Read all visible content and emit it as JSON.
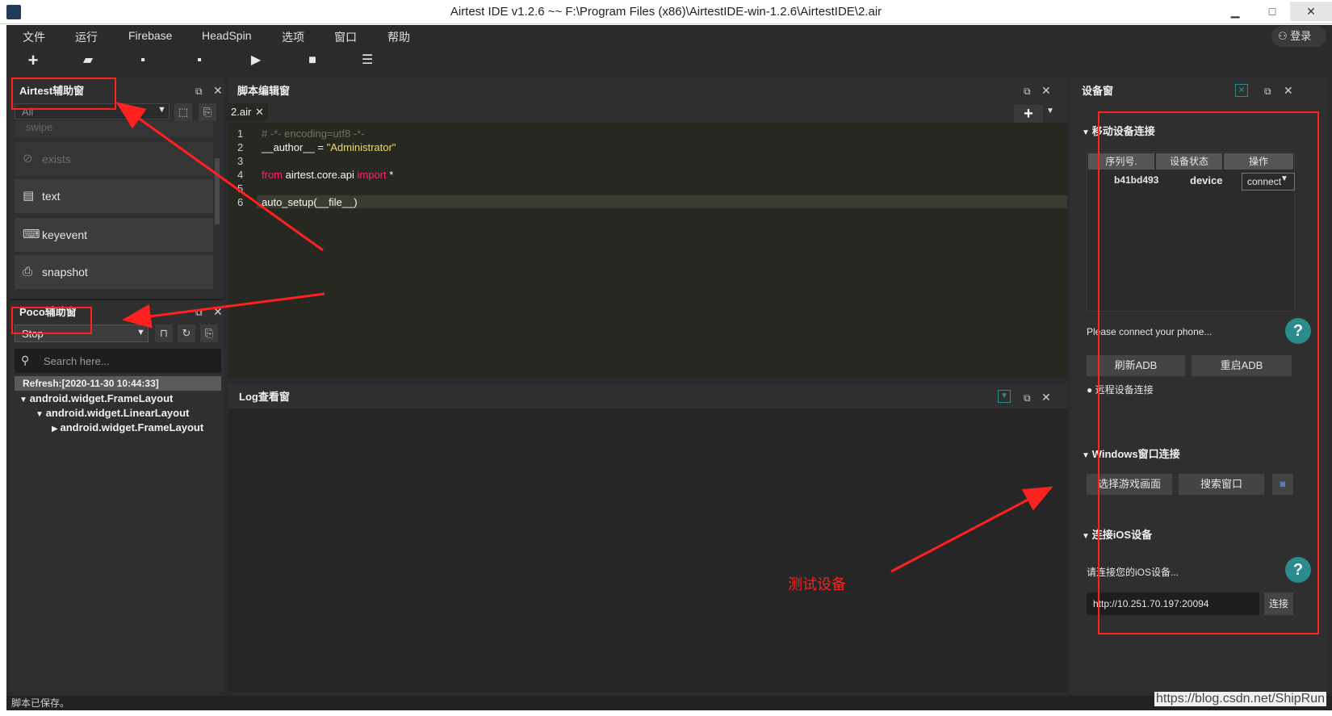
{
  "window": {
    "title": "Airtest IDE v1.2.6 ~~ F:\\Program Files (x86)\\AirtestIDE-win-1.2.6\\AirtestIDE\\2.air",
    "minimize": "▁",
    "maximize": "□",
    "close": "✕"
  },
  "menubar": {
    "items": [
      "文件",
      "运行",
      "Firebase",
      "HeadSpin",
      "选项",
      "窗口",
      "帮助"
    ],
    "login": "登录"
  },
  "toolbar": {
    "new": "+",
    "open": "▰",
    "save": "▪",
    "save_as": "▪",
    "run": "▶",
    "stop": "■",
    "log": "☰"
  },
  "airtest_panel": {
    "title": "Airtest辅助窗",
    "filter_value": "All",
    "faded_item": "swipe",
    "items": [
      "exists",
      "text",
      "keyevent",
      "snapshot"
    ]
  },
  "poco_panel": {
    "title": "Poco辅助窗",
    "mode_value": "Stop",
    "search_placeholder": "Search here...",
    "refresh_label": "Refresh:[2020-11-30 10:44:33]",
    "tree": [
      "android.widget.FrameLayout",
      "android.widget.LinearLayout",
      "android.widget.FrameLayout"
    ]
  },
  "script_panel": {
    "title": "脚本编辑窗",
    "tab_label": "2.air",
    "line_numbers": [
      "1",
      "2",
      "3",
      "4",
      "5",
      "6"
    ],
    "code": {
      "line1": "# -*- encoding=utf8 -*-",
      "line2_a": "__author__ = ",
      "line2_b": "\"Administrator\"",
      "line4_a": "from",
      "line4_b": " airtest.core.api ",
      "line4_c": "import",
      "line4_d": " *",
      "line6": "auto_setup(__file__)"
    }
  },
  "log_panel": {
    "title": "Log查看窗"
  },
  "device_panel": {
    "title": "设备窗",
    "mobile_section": "移动设备连接",
    "columns": [
      "序列号.",
      "设备状态",
      "操作"
    ],
    "device_serial": "b41bd493",
    "device_state": "device",
    "connect_label": "connect",
    "hint": "Please connect your phone...",
    "refresh_adb": "刷新ADB",
    "restart_adb": "重启ADB",
    "remote_connect": "远程设备连接",
    "windows_section": "Windows窗口连接",
    "select_game": "选择游戏画面",
    "search_window": "搜索窗口",
    "ios_section": "连接iOS设备",
    "ios_hint": "请连接您的iOS设备...",
    "ios_url": "http://10.251.70.197:20094",
    "ios_connect": "连接"
  },
  "annotation": {
    "label": "测试设备"
  },
  "statusbar": {
    "text": "脚本已保存。"
  },
  "watermark": "https://blog.csdn.net/ShipRun",
  "colors": {
    "accent_red": "#ff2020",
    "background": "#2b2b2b",
    "teal": "#2a8c8c"
  }
}
